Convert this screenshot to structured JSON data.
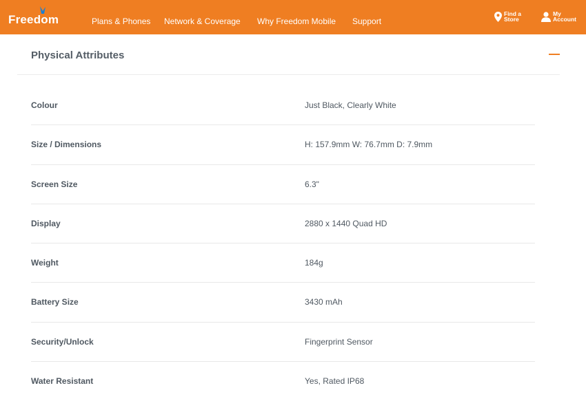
{
  "header": {
    "logo_text": "Freedom",
    "nav": [
      "Plans & Phones",
      "Network & Coverage",
      "Why Freedom Mobile",
      "Support"
    ],
    "find_store": {
      "line1": "Find a",
      "line2": "Store"
    },
    "account": {
      "line1": "My",
      "line2": "Account"
    }
  },
  "section": {
    "title": "Physical Attributes",
    "expanded": true
  },
  "specs": [
    {
      "label": "Colour",
      "value": "Just Black, Clearly White"
    },
    {
      "label": "Size / Dimensions",
      "value": "H: 157.9mm W: 76.7mm D: 7.9mm"
    },
    {
      "label": "Screen Size",
      "value": "6.3\""
    },
    {
      "label": "Display",
      "value": "2880 x 1440 Quad HD"
    },
    {
      "label": "Weight",
      "value": "184g"
    },
    {
      "label": "Battery Size",
      "value": "3430 mAh"
    },
    {
      "label": "Security/Unlock",
      "value": "Fingerprint Sensor"
    },
    {
      "label": "Water Resistant",
      "value": "Yes, Rated IP68"
    }
  ],
  "colors": {
    "brand_orange": "#ef7e22",
    "logo_accent": "#1f7fd0",
    "text": "#4f5861"
  },
  "icons": {
    "store": "location-pin-icon",
    "account": "user-icon",
    "collapse": "minus-icon"
  }
}
